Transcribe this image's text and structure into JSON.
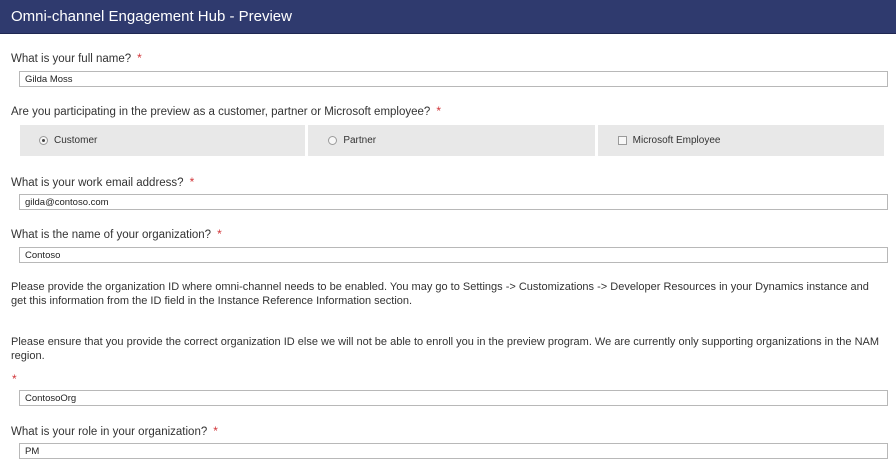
{
  "header": {
    "title": "Omni-channel Engagement Hub - Preview"
  },
  "required_marker": "*",
  "questions": {
    "full_name": {
      "label": "What is your full name?",
      "value": "Gilda Moss"
    },
    "participation": {
      "label": "Are you participating in the preview as a customer, partner or Microsoft employee?",
      "options": [
        "Customer",
        "Partner",
        "Microsoft Employee"
      ],
      "selected": "Customer"
    },
    "email": {
      "label": "What is your work email address?",
      "value": "gilda@contoso.com"
    },
    "org_name": {
      "label": "What is the name of your organization?",
      "value": "Contoso"
    },
    "org_id": {
      "instructions": "Please provide the organization ID where omni-channel needs to be enabled. You may go to Settings -> Customizations -> Developer Resources in your Dynamics instance and get this information from the ID field in the Instance Reference Information section.",
      "note": "Please ensure that you provide the correct organization ID else we will not be able to enroll you in the preview program. We are currently only supporting organizations in the NAM region.",
      "value": "ContosoOrg"
    },
    "role": {
      "label": "What is your role in your organization?",
      "value": "PM"
    }
  },
  "colors": {
    "header_bg": "#2f3a6e",
    "required": "#d13438",
    "option_bg": "#e8e8e8"
  }
}
